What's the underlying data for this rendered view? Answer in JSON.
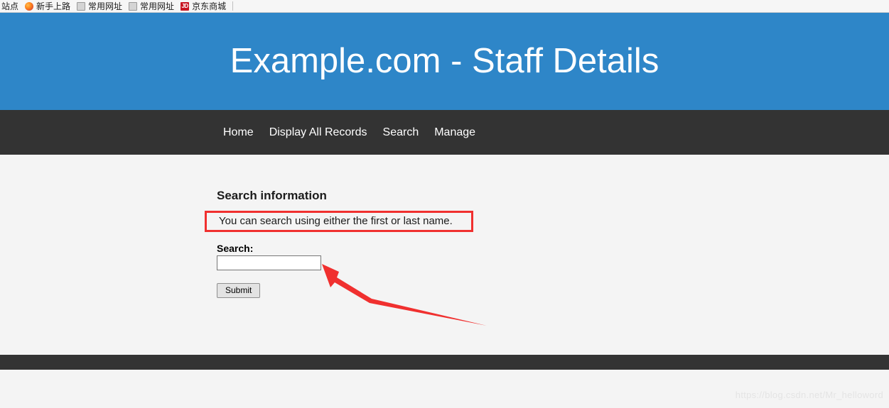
{
  "browser": {
    "bookmarks": [
      {
        "label": "站点",
        "icon": "none"
      },
      {
        "label": "新手上路",
        "icon": "firefox-icon"
      },
      {
        "label": "常用网址",
        "icon": "bookmark-blank-icon"
      },
      {
        "label": "常用网址",
        "icon": "bookmark-blank-icon"
      },
      {
        "label": "京东商城",
        "icon": "jd-icon",
        "icon_text": "JD"
      }
    ]
  },
  "header": {
    "title": "Example.com - Staff Details",
    "background_color": "#2e86c8",
    "text_color": "#ffffff"
  },
  "nav": {
    "background_color": "#333333",
    "items": [
      {
        "label": "Home"
      },
      {
        "label": "Display All Records"
      },
      {
        "label": "Search"
      },
      {
        "label": "Manage"
      }
    ]
  },
  "main": {
    "section_title": "Search information",
    "hint_text": "You can search using either the first or last name.",
    "hint_highlight_color": "#f0302f",
    "form": {
      "search_label": "Search:",
      "search_value": "",
      "search_placeholder": "",
      "submit_label": "Submit"
    }
  },
  "annotation": {
    "arrow_color": "#f0302f",
    "points_to": "search-input"
  },
  "footer": {
    "bar_color": "#333333",
    "watermark": "https://blog.csdn.net/Mr_helloword"
  }
}
